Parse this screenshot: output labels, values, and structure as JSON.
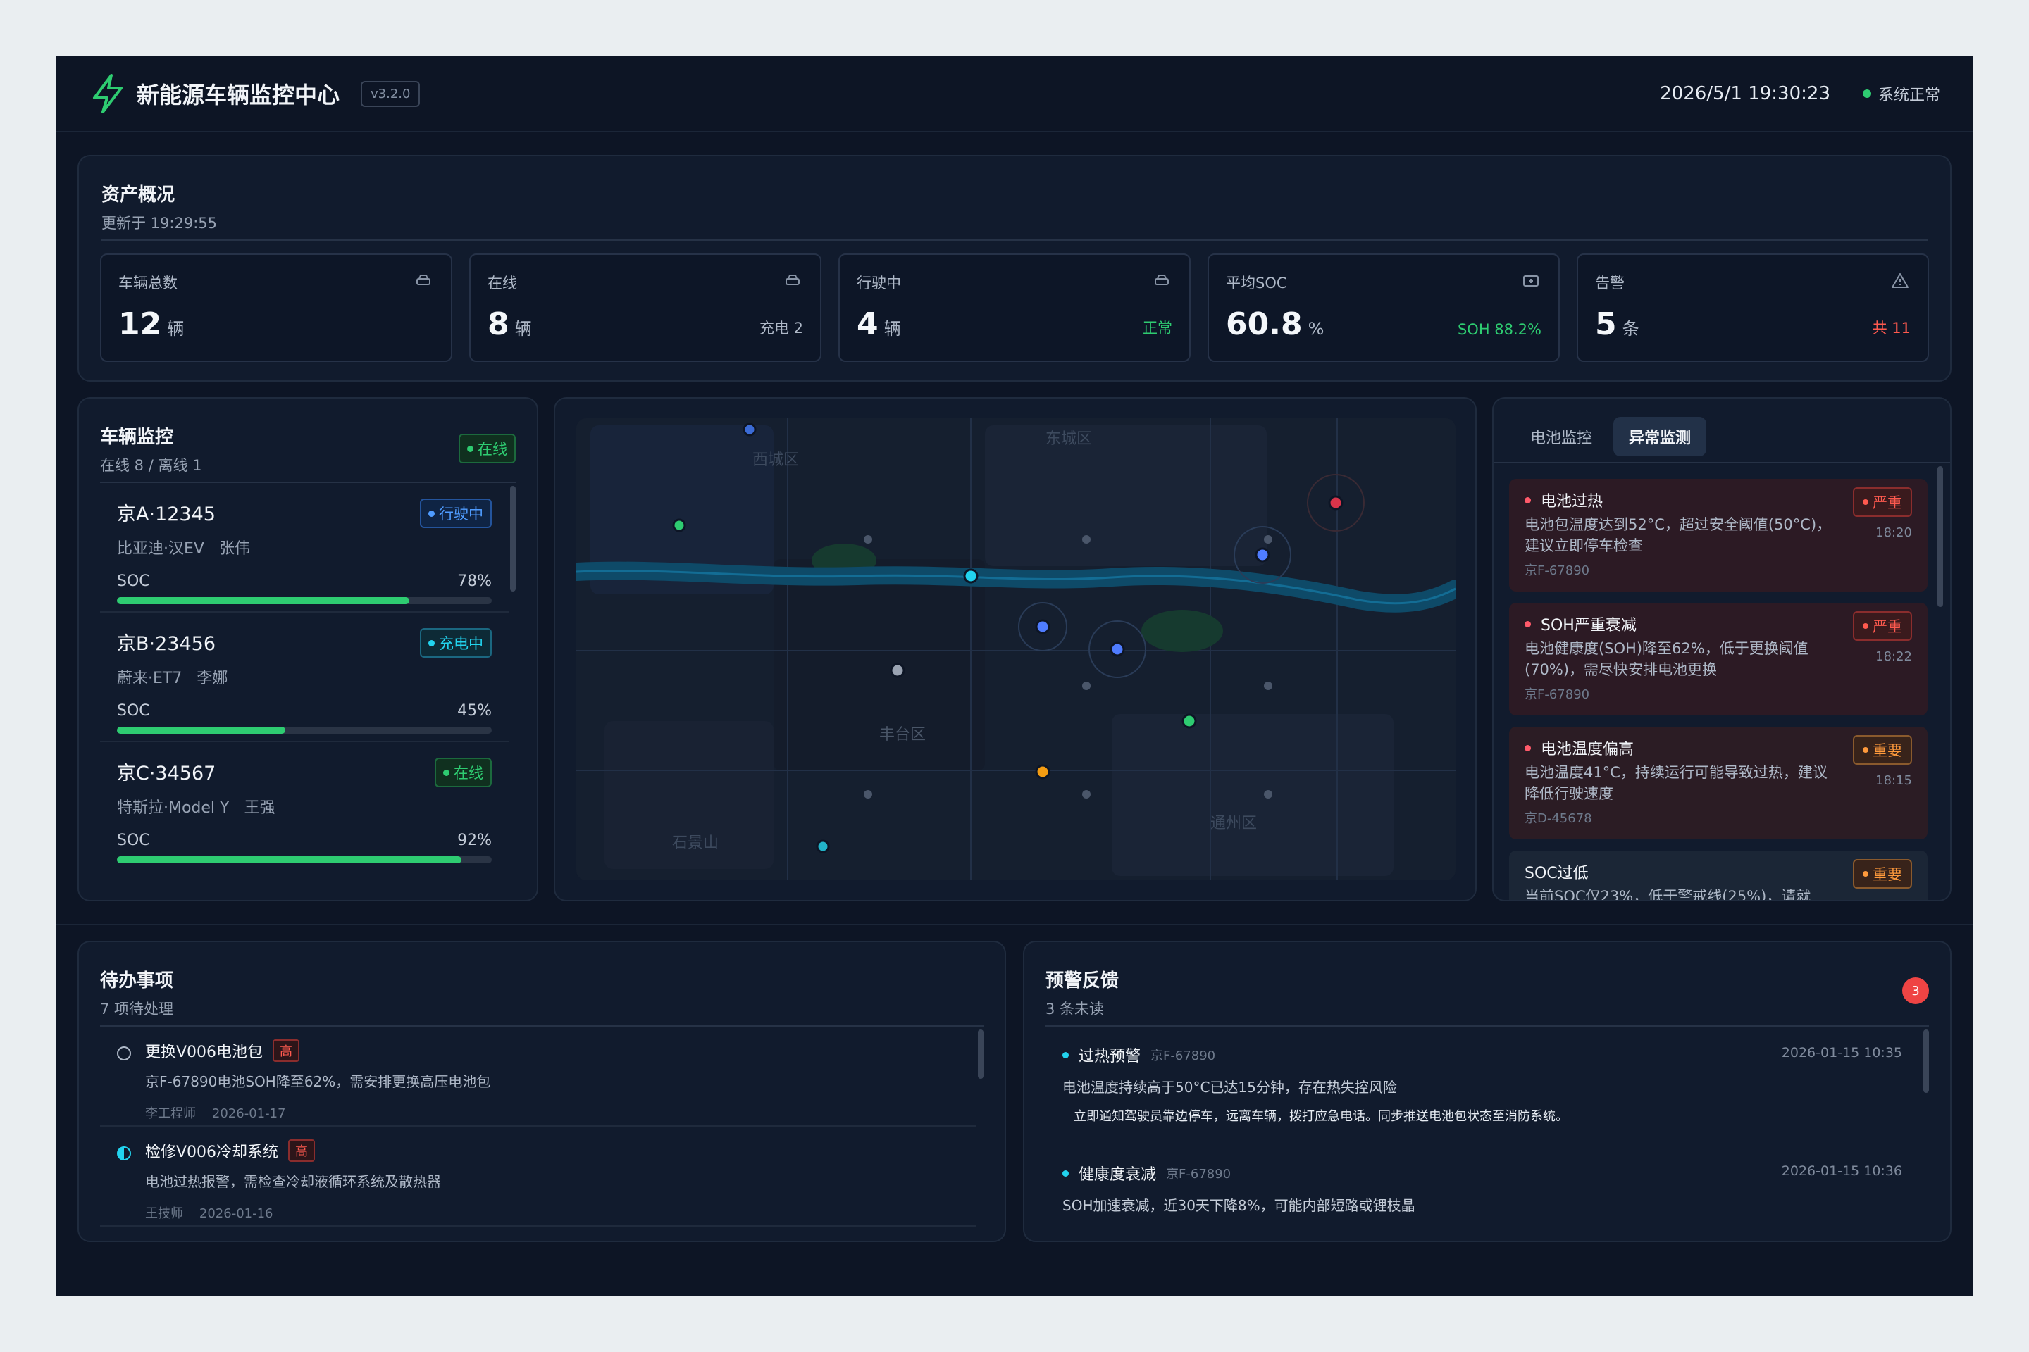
{
  "header": {
    "title": "新能源车辆监控中心",
    "version": "v3.2.0",
    "datetime": "2026/5/1 19:30:23",
    "system_status": "系统正常",
    "accent": "#2ecc71"
  },
  "assets": {
    "title": "资产概况",
    "updated": "更新于 19:29:55",
    "stats": [
      {
        "label": "车辆总数",
        "value": "12",
        "unit": "辆",
        "extra": "",
        "icon": "car-icon"
      },
      {
        "label": "在线",
        "value": "8",
        "unit": "辆",
        "extra": "充电 2",
        "icon": "car-icon"
      },
      {
        "label": "行驶中",
        "value": "4",
        "unit": "辆",
        "extra": "正常",
        "icon": "car-icon"
      },
      {
        "label": "平均SOC",
        "value": "60.8",
        "unit": "%",
        "extra": "SOH 88.2%",
        "icon": "battery-icon"
      },
      {
        "label": "告警",
        "value": "5",
        "unit": "条",
        "extra": "共 11",
        "icon": "warning-icon"
      }
    ]
  },
  "vehicles": {
    "title": "车辆监控",
    "subtitle": "在线 8 / 离线 1",
    "status_badge": "在线",
    "items": [
      {
        "plate": "京A·12345",
        "model": "比亚迪·汉EV",
        "driver": "张伟",
        "status": "行驶中",
        "soc_label": "SOC",
        "soc": "78%",
        "soc_value": 78
      },
      {
        "plate": "京B·23456",
        "model": "蔚来·ET7",
        "driver": "李娜",
        "status": "充电中",
        "soc_label": "SOC",
        "soc": "45%",
        "soc_value": 45
      },
      {
        "plate": "京C·34567",
        "model": "特斯拉·Model Y",
        "driver": "王强",
        "status": "在线",
        "soc_label": "SOC",
        "soc": "92%",
        "soc_value": 92
      }
    ]
  },
  "map": {
    "districts": [
      "西城区",
      "东城区",
      "丰台区",
      "通州区",
      "石景山"
    ]
  },
  "alerts": {
    "tabs": [
      "电池监控",
      "异常监测"
    ],
    "active_tab": 1,
    "items": [
      {
        "title": "电池过热",
        "desc": "电池包温度达到52°C，超过安全阈值(50°C)，建议立即停车检查",
        "plate": "京F-67890",
        "level": "严重",
        "time": "18:20"
      },
      {
        "title": "SOH严重衰减",
        "desc": "电池健康度(SOH)降至62%，低于更换阈值(70%)，需尽快安排电池更换",
        "plate": "京F-67890",
        "level": "严重",
        "time": "18:22"
      },
      {
        "title": "电池温度偏高",
        "desc": "电池温度41°C，持续运行可能导致过热，建议降低行驶速度",
        "plate": "京D-45678",
        "level": "重要",
        "time": "18:15"
      },
      {
        "title": "SOC过低",
        "desc": "当前SOC仅23%，低于警戒线(25%)，请就",
        "plate": "",
        "level": "重要",
        "time": ""
      }
    ]
  },
  "todos": {
    "title": "待办事项",
    "subtitle": "7 项待处理",
    "items": [
      {
        "title": "更换V006电池包",
        "priority": "高",
        "desc": "京F-67890电池SOH降至62%，需安排更换高压电池包",
        "assignee": "李工程师",
        "date": "2026-01-17"
      },
      {
        "title": "检修V006冷却系统",
        "priority": "高",
        "desc": "电池过热报警，需检查冷却液循环系统及散热器",
        "assignee": "王技师",
        "date": "2026-01-16"
      }
    ]
  },
  "feedback": {
    "title": "预警反馈",
    "subtitle": "3 条未读",
    "count": "3",
    "items": [
      {
        "title": "过热预警",
        "plate": "京F-67890",
        "time": "2026-01-15 10:35",
        "desc": "电池温度持续高于50°C已达15分钟，存在热失控风险",
        "action": "立即通知驾驶员靠边停车，远离车辆，拨打应急电话。同步推送电池包状态至消防系统。"
      },
      {
        "title": "健康度衰减",
        "plate": "京F-67890",
        "time": "2026-01-15 10:36",
        "desc": "SOH加速衰减，近30天下降8%，可能内部短路或锂枝晶",
        "action": ""
      }
    ]
  }
}
